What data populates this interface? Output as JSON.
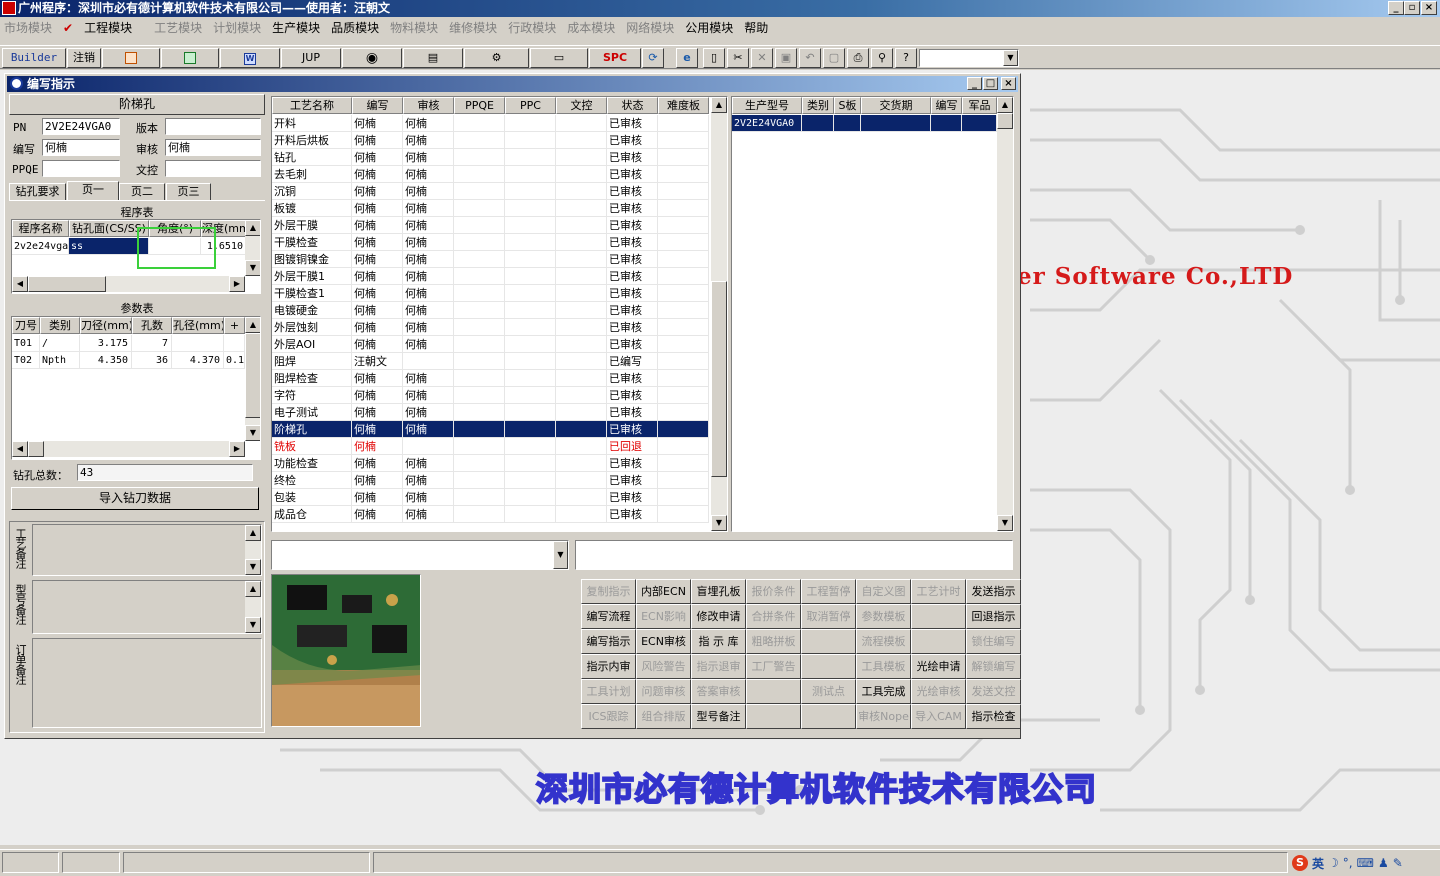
{
  "app": {
    "title": "广州程序：深圳市必有德计算机软件技术有限公司——使用者：汪朝文",
    "menu": [
      "市场模块",
      "工程模块",
      "工艺模块",
      "计划模块",
      "生产模块",
      "品质模块",
      "物料模块",
      "维修模块",
      "行政模块",
      "成本模块",
      "网络模块",
      "公用模块",
      "帮助"
    ],
    "window_buttons": [
      "_",
      "▫",
      "×"
    ]
  },
  "toolbar": {
    "builder_label": "Builder",
    "logout_label": "注销",
    "jup_label": "JUP",
    "spc_label": "SPC"
  },
  "background": {
    "company_en": "er Software Co.,LTD",
    "company_cn": "深圳市必有德计算机软件技术有限公司"
  },
  "child_window": {
    "title": "编写指示",
    "buttons": [
      "_",
      "□",
      "×"
    ]
  },
  "left": {
    "header": "阶梯孔",
    "pn_label": "PN",
    "pn_value": "2V2E24VGA0",
    "version_label": "版本",
    "version_value": "",
    "writer_label": "编写",
    "writer_value": "何楠",
    "reviewer_label": "审核",
    "reviewer_value": "何楠",
    "ppqe_label": "PPQE",
    "ppqe_value": "",
    "doccontrol_label": "文控",
    "doccontrol_value": "",
    "tabs": [
      "钻孔要求",
      "页一",
      "页二",
      "页三"
    ],
    "program_table_title": "程序表",
    "program_headers": [
      "程序名称",
      "钻孔面(CS/SS)",
      "角度(°)",
      "深度(mm)"
    ],
    "program_rows": [
      [
        "2v2e24vga",
        "ss",
        "",
        "1.6510"
      ]
    ],
    "param_table_title": "参数表",
    "param_headers": [
      "刀号",
      "类别",
      "刀径(mm)",
      "孔数",
      "孔径(mm)",
      "+"
    ],
    "param_rows": [
      [
        "T01",
        "/",
        "3.175",
        "7",
        "",
        ""
      ],
      [
        "T02",
        "Npth",
        "4.350",
        "36",
        "4.370",
        "0.1"
      ]
    ],
    "drill_total_label": "钻孔总数：",
    "drill_total_value": "43",
    "import_button": "导入钻刀数据",
    "note_labels": [
      "工艺备注",
      "型号备注",
      "订单备注"
    ]
  },
  "process_table": {
    "headers": [
      "工艺名称",
      "编写",
      "审核",
      "PPQE",
      "PPC",
      "文控",
      "状态",
      "难度板"
    ],
    "rows": [
      [
        "开料",
        "何楠",
        "何楠",
        "",
        "",
        "",
        "已审核",
        ""
      ],
      [
        "开料后烘板",
        "何楠",
        "何楠",
        "",
        "",
        "",
        "已审核",
        ""
      ],
      [
        "钻孔",
        "何楠",
        "何楠",
        "",
        "",
        "",
        "已审核",
        ""
      ],
      [
        "去毛刺",
        "何楠",
        "何楠",
        "",
        "",
        "",
        "已审核",
        ""
      ],
      [
        "沉铜",
        "何楠",
        "何楠",
        "",
        "",
        "",
        "已审核",
        ""
      ],
      [
        "板镀",
        "何楠",
        "何楠",
        "",
        "",
        "",
        "已审核",
        ""
      ],
      [
        "外层干膜",
        "何楠",
        "何楠",
        "",
        "",
        "",
        "已审核",
        ""
      ],
      [
        "干膜检查",
        "何楠",
        "何楠",
        "",
        "",
        "",
        "已审核",
        ""
      ],
      [
        "图镀铜镍金",
        "何楠",
        "何楠",
        "",
        "",
        "",
        "已审核",
        ""
      ],
      [
        "外层干膜1",
        "何楠",
        "何楠",
        "",
        "",
        "",
        "已审核",
        ""
      ],
      [
        "干膜检查1",
        "何楠",
        "何楠",
        "",
        "",
        "",
        "已审核",
        ""
      ],
      [
        "电镀硬金",
        "何楠",
        "何楠",
        "",
        "",
        "",
        "已审核",
        ""
      ],
      [
        "外层蚀刻",
        "何楠",
        "何楠",
        "",
        "",
        "",
        "已审核",
        ""
      ],
      [
        "外层AOI",
        "何楠",
        "何楠",
        "",
        "",
        "",
        "已审核",
        ""
      ],
      [
        "阻焊",
        "汪朝文",
        "",
        "",
        "",
        "",
        "已编写",
        ""
      ],
      [
        "阻焊检查",
        "何楠",
        "何楠",
        "",
        "",
        "",
        "已审核",
        ""
      ],
      [
        "字符",
        "何楠",
        "何楠",
        "",
        "",
        "",
        "已审核",
        ""
      ],
      [
        "电子测试",
        "何楠",
        "何楠",
        "",
        "",
        "",
        "已审核",
        ""
      ],
      [
        "阶梯孔",
        "何楠",
        "何楠",
        "",
        "",
        "",
        "已审核",
        ""
      ],
      [
        "铣板",
        "何楠",
        "",
        "",
        "",
        "",
        "已回退",
        ""
      ],
      [
        "功能检查",
        "何楠",
        "何楠",
        "",
        "",
        "",
        "已审核",
        ""
      ],
      [
        "终检",
        "何楠",
        "何楠",
        "",
        "",
        "",
        "已审核",
        ""
      ],
      [
        "包装",
        "何楠",
        "何楠",
        "",
        "",
        "",
        "已审核",
        ""
      ],
      [
        "成品仓",
        "何楠",
        "何楠",
        "",
        "",
        "",
        "已审核",
        ""
      ]
    ],
    "selected_index": 18,
    "rejected_index": 19
  },
  "model_table": {
    "headers": [
      "生产型号",
      "类别",
      "S板",
      "交货期",
      "编写",
      "军品"
    ],
    "rows": [
      [
        "2V2E24VGA0",
        "",
        "",
        "",
        "",
        ""
      ]
    ]
  },
  "action_buttons": [
    {
      "label": "复制指示",
      "enabled": false
    },
    {
      "label": "内部ECN",
      "enabled": true
    },
    {
      "label": "盲埋孔板",
      "enabled": true
    },
    {
      "label": "报价条件",
      "enabled": false
    },
    {
      "label": "工程暂停",
      "enabled": false
    },
    {
      "label": "自定义图",
      "enabled": false
    },
    {
      "label": "工艺计时",
      "enabled": false
    },
    {
      "label": "发送指示",
      "enabled": true
    },
    {
      "label": "编写流程",
      "enabled": true
    },
    {
      "label": "ECN影响",
      "enabled": false
    },
    {
      "label": "修改申请",
      "enabled": true
    },
    {
      "label": "合拼条件",
      "enabled": false
    },
    {
      "label": "取消暂停",
      "enabled": false
    },
    {
      "label": "参数模板",
      "enabled": false
    },
    {
      "label": "",
      "enabled": false
    },
    {
      "label": "回退指示",
      "enabled": true
    },
    {
      "label": "编写指示",
      "enabled": true
    },
    {
      "label": "ECN审核",
      "enabled": true
    },
    {
      "label": "指 示 库",
      "enabled": true
    },
    {
      "label": "粗略拼板",
      "enabled": false
    },
    {
      "label": "",
      "enabled": false
    },
    {
      "label": "流程模板",
      "enabled": false
    },
    {
      "label": "",
      "enabled": false
    },
    {
      "label": "锁住编写",
      "enabled": false
    },
    {
      "label": "指示内审",
      "enabled": true
    },
    {
      "label": "风险警告",
      "enabled": false
    },
    {
      "label": "指示退审",
      "enabled": false
    },
    {
      "label": "工厂警告",
      "enabled": false
    },
    {
      "label": "",
      "enabled": false
    },
    {
      "label": "工具模板",
      "enabled": false
    },
    {
      "label": "光绘申请",
      "enabled": true
    },
    {
      "label": "解锁编写",
      "enabled": false
    },
    {
      "label": "工具计划",
      "enabled": false
    },
    {
      "label": "问题审核",
      "enabled": false
    },
    {
      "label": "答案审核",
      "enabled": false
    },
    {
      "label": "",
      "enabled": false
    },
    {
      "label": "测试点",
      "enabled": false
    },
    {
      "label": "工具完成",
      "enabled": true
    },
    {
      "label": "光绘审核",
      "enabled": false
    },
    {
      "label": "发送文控",
      "enabled": false
    },
    {
      "label": "ICS跟踪",
      "enabled": false
    },
    {
      "label": "组合排版",
      "enabled": false
    },
    {
      "label": "型号备注",
      "enabled": true
    },
    {
      "label": "",
      "enabled": false
    },
    {
      "label": "",
      "enabled": false
    },
    {
      "label": "审核Nope",
      "enabled": false
    },
    {
      "label": "导入CAM",
      "enabled": false
    },
    {
      "label": "指示检查",
      "enabled": true
    }
  ],
  "taskbar": {
    "ime_label": "英"
  }
}
